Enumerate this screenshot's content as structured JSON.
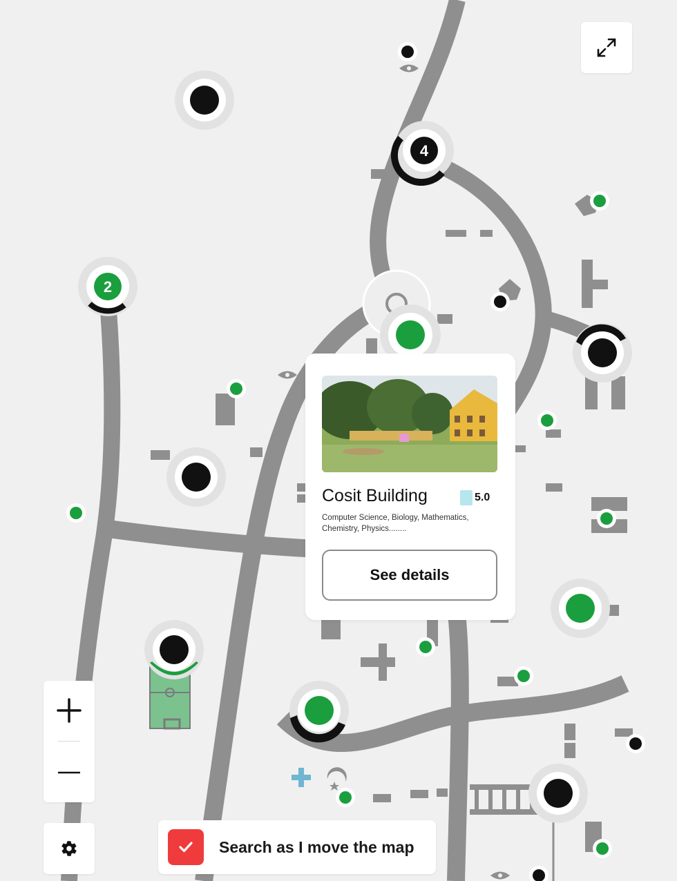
{
  "map": {
    "clusters": [
      {
        "count": "2",
        "color": "#1b9e3e"
      },
      {
        "count": "4",
        "color": "#111111"
      }
    ]
  },
  "popup": {
    "title": "Cosit Building",
    "rating": "5.0",
    "description": "Computer Science, Biology, Mathematics, Chemistry, Physics........",
    "button_label": "See details"
  },
  "controls": {
    "expand_icon": "expand-arrows-icon",
    "zoom_in_icon": "plus-icon",
    "zoom_out_icon": "minus-icon",
    "settings_icon": "gear-icon"
  },
  "search_toggle": {
    "label": "Search as I move the map",
    "checked": true,
    "accent": "#ef3b3b"
  },
  "colors": {
    "road": "#8f8f8f",
    "marker_green": "#1b9e3e",
    "marker_black": "#111111",
    "background": "#f0f0f0"
  }
}
